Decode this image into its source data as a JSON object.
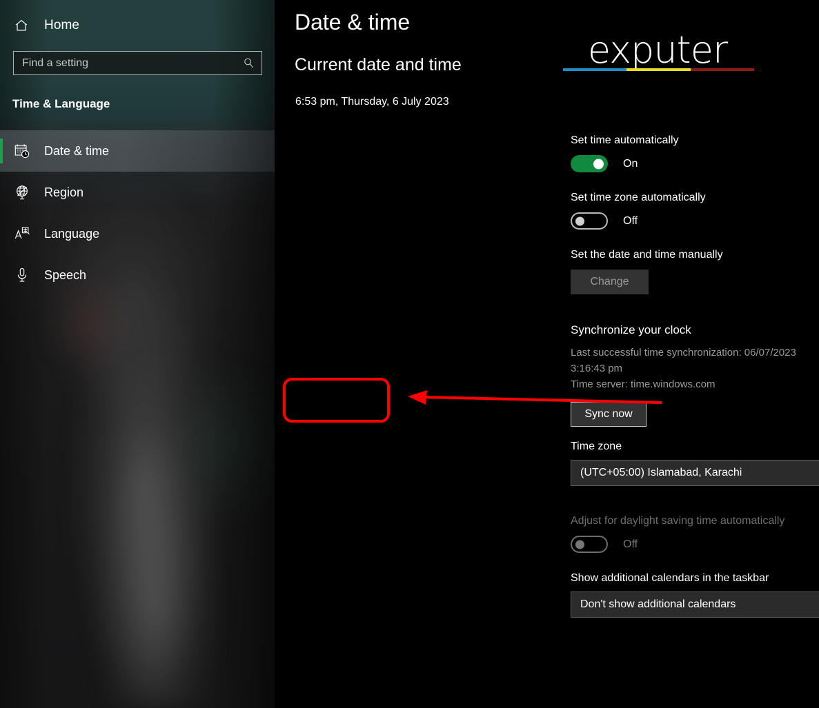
{
  "sidebar": {
    "home": {
      "label": "Home",
      "icon": "home-icon"
    },
    "search": {
      "placeholder": "Find a setting",
      "value": "",
      "icon": "search-icon"
    },
    "section_title": "Time & Language",
    "items": [
      {
        "label": "Date & time",
        "icon": "calendar-clock-icon",
        "selected": true
      },
      {
        "label": "Region",
        "icon": "globe-icon",
        "selected": false
      },
      {
        "label": "Language",
        "icon": "language-icon",
        "selected": false
      },
      {
        "label": "Speech",
        "icon": "microphone-icon",
        "selected": false
      }
    ],
    "accent_color": "#18a04a"
  },
  "main": {
    "page_title": "Date & time",
    "current_section_heading": "Current date and time",
    "current_datetime": "6:53 pm, Thursday, 6 July 2023",
    "set_time_auto": {
      "label": "Set time automatically",
      "state": "On",
      "toggle_color": "#11893e"
    },
    "set_timezone_auto": {
      "label": "Set time zone automatically",
      "state": "Off"
    },
    "manual": {
      "label": "Set the date and time manually",
      "button_label": "Change",
      "button_enabled": false
    },
    "synchronize": {
      "heading": "Synchronize your clock",
      "last_sync": "Last successful time synchronization: 06/07/2023 3:16:43 pm",
      "time_server": "Time server: time.windows.com",
      "button_label": "Sync now"
    },
    "time_zone": {
      "label": "Time zone",
      "selected": "(UTC+05:00) Islamabad, Karachi"
    },
    "daylight_saving": {
      "label": "Adjust for daylight saving time automatically",
      "state": "Off",
      "disabled": true
    },
    "additional_calendars": {
      "label": "Show additional calendars in the taskbar",
      "selected": "Don't show additional calendars"
    }
  },
  "logo": {
    "text": "exputer",
    "bar_colors": [
      "#1b8ecb",
      "#e8d926",
      "#8f1a15"
    ]
  },
  "annotation": {
    "highlight_color": "#ff0000",
    "target": "Sync now"
  }
}
